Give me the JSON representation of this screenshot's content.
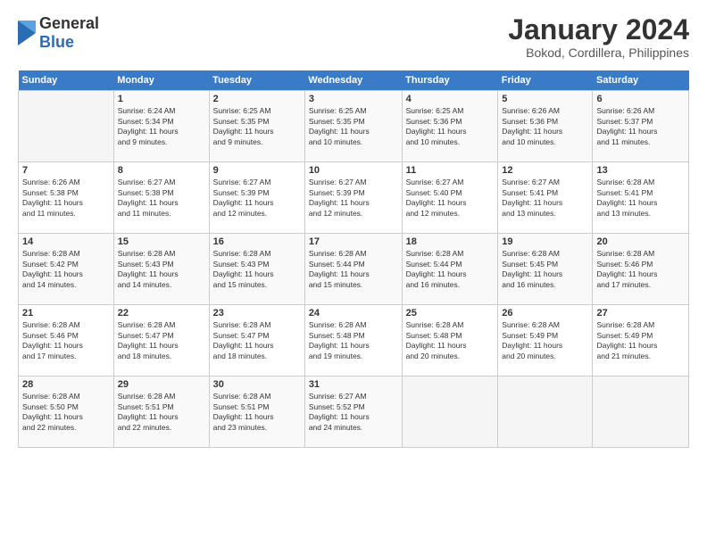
{
  "logo": {
    "general": "General",
    "blue": "Blue"
  },
  "header": {
    "month": "January 2024",
    "location": "Bokod, Cordillera, Philippines"
  },
  "weekdays": [
    "Sunday",
    "Monday",
    "Tuesday",
    "Wednesday",
    "Thursday",
    "Friday",
    "Saturday"
  ],
  "weeks": [
    [
      {
        "day": "",
        "info": ""
      },
      {
        "day": "1",
        "info": "Sunrise: 6:24 AM\nSunset: 5:34 PM\nDaylight: 11 hours\nand 9 minutes."
      },
      {
        "day": "2",
        "info": "Sunrise: 6:25 AM\nSunset: 5:35 PM\nDaylight: 11 hours\nand 9 minutes."
      },
      {
        "day": "3",
        "info": "Sunrise: 6:25 AM\nSunset: 5:35 PM\nDaylight: 11 hours\nand 10 minutes."
      },
      {
        "day": "4",
        "info": "Sunrise: 6:25 AM\nSunset: 5:36 PM\nDaylight: 11 hours\nand 10 minutes."
      },
      {
        "day": "5",
        "info": "Sunrise: 6:26 AM\nSunset: 5:36 PM\nDaylight: 11 hours\nand 10 minutes."
      },
      {
        "day": "6",
        "info": "Sunrise: 6:26 AM\nSunset: 5:37 PM\nDaylight: 11 hours\nand 11 minutes."
      }
    ],
    [
      {
        "day": "7",
        "info": "Sunrise: 6:26 AM\nSunset: 5:38 PM\nDaylight: 11 hours\nand 11 minutes."
      },
      {
        "day": "8",
        "info": "Sunrise: 6:27 AM\nSunset: 5:38 PM\nDaylight: 11 hours\nand 11 minutes."
      },
      {
        "day": "9",
        "info": "Sunrise: 6:27 AM\nSunset: 5:39 PM\nDaylight: 11 hours\nand 12 minutes."
      },
      {
        "day": "10",
        "info": "Sunrise: 6:27 AM\nSunset: 5:39 PM\nDaylight: 11 hours\nand 12 minutes."
      },
      {
        "day": "11",
        "info": "Sunrise: 6:27 AM\nSunset: 5:40 PM\nDaylight: 11 hours\nand 12 minutes."
      },
      {
        "day": "12",
        "info": "Sunrise: 6:27 AM\nSunset: 5:41 PM\nDaylight: 11 hours\nand 13 minutes."
      },
      {
        "day": "13",
        "info": "Sunrise: 6:28 AM\nSunset: 5:41 PM\nDaylight: 11 hours\nand 13 minutes."
      }
    ],
    [
      {
        "day": "14",
        "info": "Sunrise: 6:28 AM\nSunset: 5:42 PM\nDaylight: 11 hours\nand 14 minutes."
      },
      {
        "day": "15",
        "info": "Sunrise: 6:28 AM\nSunset: 5:43 PM\nDaylight: 11 hours\nand 14 minutes."
      },
      {
        "day": "16",
        "info": "Sunrise: 6:28 AM\nSunset: 5:43 PM\nDaylight: 11 hours\nand 15 minutes."
      },
      {
        "day": "17",
        "info": "Sunrise: 6:28 AM\nSunset: 5:44 PM\nDaylight: 11 hours\nand 15 minutes."
      },
      {
        "day": "18",
        "info": "Sunrise: 6:28 AM\nSunset: 5:44 PM\nDaylight: 11 hours\nand 16 minutes."
      },
      {
        "day": "19",
        "info": "Sunrise: 6:28 AM\nSunset: 5:45 PM\nDaylight: 11 hours\nand 16 minutes."
      },
      {
        "day": "20",
        "info": "Sunrise: 6:28 AM\nSunset: 5:46 PM\nDaylight: 11 hours\nand 17 minutes."
      }
    ],
    [
      {
        "day": "21",
        "info": "Sunrise: 6:28 AM\nSunset: 5:46 PM\nDaylight: 11 hours\nand 17 minutes."
      },
      {
        "day": "22",
        "info": "Sunrise: 6:28 AM\nSunset: 5:47 PM\nDaylight: 11 hours\nand 18 minutes."
      },
      {
        "day": "23",
        "info": "Sunrise: 6:28 AM\nSunset: 5:47 PM\nDaylight: 11 hours\nand 18 minutes."
      },
      {
        "day": "24",
        "info": "Sunrise: 6:28 AM\nSunset: 5:48 PM\nDaylight: 11 hours\nand 19 minutes."
      },
      {
        "day": "25",
        "info": "Sunrise: 6:28 AM\nSunset: 5:48 PM\nDaylight: 11 hours\nand 20 minutes."
      },
      {
        "day": "26",
        "info": "Sunrise: 6:28 AM\nSunset: 5:49 PM\nDaylight: 11 hours\nand 20 minutes."
      },
      {
        "day": "27",
        "info": "Sunrise: 6:28 AM\nSunset: 5:49 PM\nDaylight: 11 hours\nand 21 minutes."
      }
    ],
    [
      {
        "day": "28",
        "info": "Sunrise: 6:28 AM\nSunset: 5:50 PM\nDaylight: 11 hours\nand 22 minutes."
      },
      {
        "day": "29",
        "info": "Sunrise: 6:28 AM\nSunset: 5:51 PM\nDaylight: 11 hours\nand 22 minutes."
      },
      {
        "day": "30",
        "info": "Sunrise: 6:28 AM\nSunset: 5:51 PM\nDaylight: 11 hours\nand 23 minutes."
      },
      {
        "day": "31",
        "info": "Sunrise: 6:27 AM\nSunset: 5:52 PM\nDaylight: 11 hours\nand 24 minutes."
      },
      {
        "day": "",
        "info": ""
      },
      {
        "day": "",
        "info": ""
      },
      {
        "day": "",
        "info": ""
      }
    ]
  ]
}
